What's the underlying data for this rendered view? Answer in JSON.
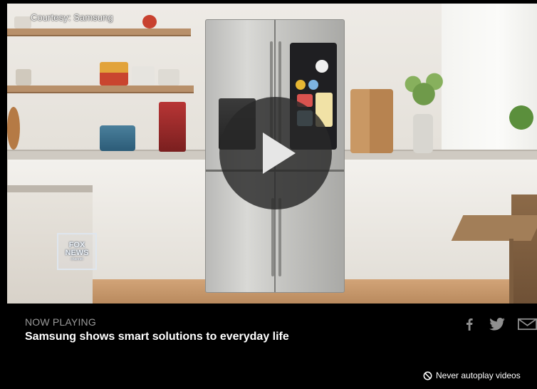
{
  "video": {
    "courtesy_text": "Courtesy: Samsung",
    "logo_line1": "FOX",
    "logo_line2": "NEWS",
    "logo_line3": "channel"
  },
  "now_playing": {
    "label": "NOW PLAYING",
    "title": "Samsung shows smart solutions to everyday life"
  },
  "share_icons": [
    "facebook-icon",
    "twitter-icon",
    "email-icon"
  ],
  "autoplay": {
    "label": "Never autoplay videos",
    "icon": "no-symbol-icon"
  },
  "colors": {
    "background": "#000000",
    "label_gray": "#9a9a9a",
    "icon_gray": "#8f8f8f"
  }
}
